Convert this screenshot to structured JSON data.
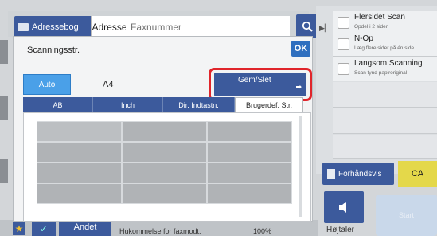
{
  "topbar": {
    "address_book": "Adressebog",
    "address": "Adresse",
    "fax_placeholder": "Faxnummer"
  },
  "right_panel": {
    "options": [
      {
        "title": "Flersidet Scan",
        "subtitle": "Opdel i 2 sider"
      },
      {
        "title": "N-Op",
        "subtitle": "Læg flere sider på én side"
      },
      {
        "title": "Langsom Scanning",
        "subtitle": "Scan tynd papiroriginal"
      }
    ],
    "preview": "Forhåndsvis",
    "ca": "CA",
    "speaker": "Højtaler",
    "start": "Start"
  },
  "dialog": {
    "title": "Scanningsstr.",
    "ok": "OK",
    "auto": "Auto",
    "size_value": "A4",
    "save_delete": "Gem/Slet",
    "tabs": [
      "AB",
      "Inch",
      "Dir. Indtastn.",
      "Brugerdef. Str."
    ],
    "active_tab": "Brugerdef. Str."
  },
  "bottombar": {
    "other": "Andet",
    "memory_label": "Hukommelse for faxmodt.",
    "memory_value": "100%"
  },
  "colors": {
    "accent": "#3c5a9c",
    "highlight_frame": "#e0252b",
    "auto_button": "#4aa0e8",
    "ca_button": "#e4d84a"
  }
}
